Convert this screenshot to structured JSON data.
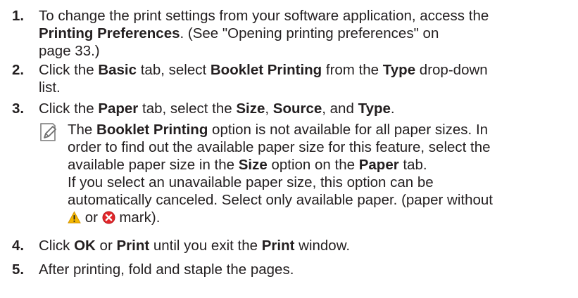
{
  "steps": [
    {
      "num": "1.",
      "lines": [
        [
          {
            "t": "To change the print settings from your software application, access the",
            "b": false
          }
        ],
        [
          {
            "t": "Printing Preferences",
            "b": true
          },
          {
            "t": ". (See \"Opening printing preferences\" on",
            "b": false
          }
        ],
        [
          {
            "t": "page 33.)",
            "b": false
          }
        ]
      ]
    },
    {
      "num": "2.",
      "lines": [
        [
          {
            "t": "Click the ",
            "b": false
          },
          {
            "t": "Basic",
            "b": true
          },
          {
            "t": " tab, select ",
            "b": false
          },
          {
            "t": "Booklet Printing",
            "b": true
          },
          {
            "t": " from the ",
            "b": false
          },
          {
            "t": "Type",
            "b": true
          },
          {
            "t": " drop-down",
            "b": false
          }
        ],
        [
          {
            "t": "list.",
            "b": false
          }
        ]
      ]
    },
    {
      "num": "3.",
      "lines": [
        [
          {
            "t": "Click the ",
            "b": false
          },
          {
            "t": "Paper",
            "b": true
          },
          {
            "t": " tab, select the ",
            "b": false
          },
          {
            "t": "Size",
            "b": true
          },
          {
            "t": ", ",
            "b": false
          },
          {
            "t": "Source",
            "b": true
          },
          {
            "t": ", and ",
            "b": false
          },
          {
            "t": "Type",
            "b": true
          },
          {
            "t": ".",
            "b": false
          }
        ]
      ]
    },
    {
      "num": "4.",
      "lines": [
        [
          {
            "t": "Click ",
            "b": false
          },
          {
            "t": "OK",
            "b": true
          },
          {
            "t": " or ",
            "b": false
          },
          {
            "t": "Print",
            "b": true
          },
          {
            "t": " until you exit the ",
            "b": false
          },
          {
            "t": "Print",
            "b": true
          },
          {
            "t": " window.",
            "b": false
          }
        ]
      ]
    },
    {
      "num": "5.",
      "lines": [
        [
          {
            "t": "After printing, fold and staple the pages.",
            "b": false
          }
        ]
      ]
    }
  ],
  "note": {
    "icon": "note-pencil-icon",
    "lines": [
      [
        {
          "t": "The ",
          "b": false
        },
        {
          "t": "Booklet Printing",
          "b": true
        },
        {
          "t": " option is not available for all paper sizes. In",
          "b": false
        }
      ],
      [
        {
          "t": "order to find out the available paper size for this feature, select the",
          "b": false
        }
      ],
      [
        {
          "t": "available paper size in the ",
          "b": false
        },
        {
          "t": "Size",
          "b": true
        },
        {
          "t": " option on the ",
          "b": false
        },
        {
          "t": "Paper",
          "b": true
        },
        {
          "t": " tab.",
          "b": false
        }
      ],
      [
        {
          "t": "If you select an unavailable paper size, this option can be",
          "b": false
        }
      ],
      [
        {
          "t": "automatically canceled. Select only available paper. (paper without",
          "b": false
        }
      ]
    ],
    "last_line": {
      "warning_icon": "warning-triangle-icon",
      "or": " or ",
      "error_icon": "error-x-icon",
      "after": " mark)."
    }
  }
}
